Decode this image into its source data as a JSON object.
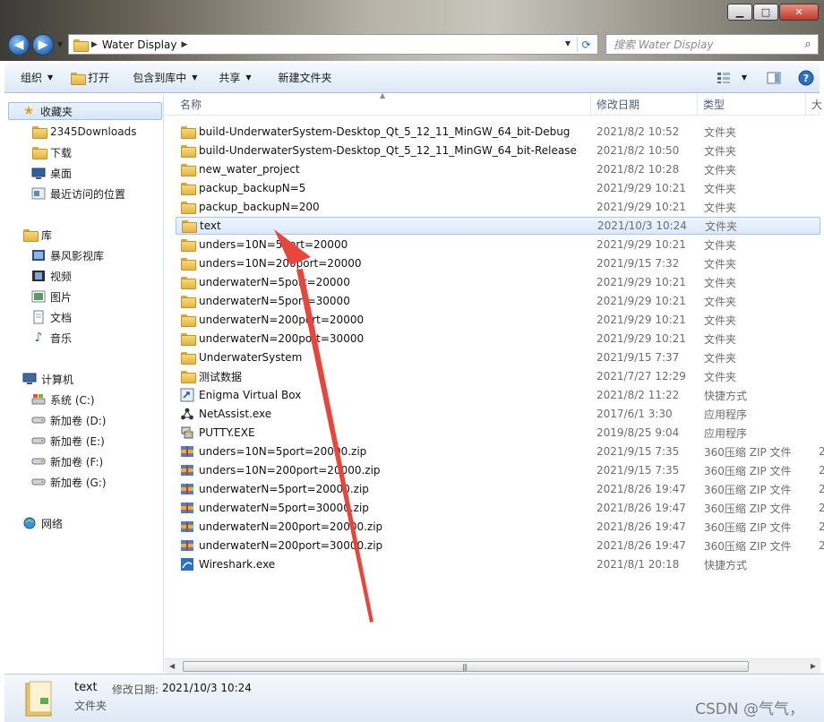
{
  "window": {
    "minimize_label": "▁",
    "maximize_label": "□",
    "close_label": "✕"
  },
  "address": {
    "crumbs": [
      "Water Display"
    ]
  },
  "search": {
    "placeholder": "搜索 Water Display"
  },
  "toolbar": {
    "organize": "组织",
    "open": "打开",
    "include_in_library": "包含到库中",
    "share": "共享",
    "new_folder": "新建文件夹"
  },
  "nav": {
    "favorites": "收藏夹",
    "favorites_items": [
      "2345Downloads",
      "下载",
      "桌面",
      "最近访问的位置"
    ],
    "libraries": "库",
    "libraries_items": [
      "暴风影视库",
      "视频",
      "图片",
      "文档",
      "音乐"
    ],
    "computer": "计算机",
    "computer_items": [
      "系统 (C:)",
      "新加卷 (D:)",
      "新加卷 (E:)",
      "新加卷 (F:)",
      "新加卷 (G:)"
    ],
    "network": "网络"
  },
  "columns": {
    "name": "名称",
    "modified": "修改日期",
    "type": "类型",
    "size": "大"
  },
  "files": [
    {
      "name": "build-UnderwaterSystem-Desktop_Qt_5_12_11_MinGW_64_bit-Debug",
      "date": "2021/8/2 10:52",
      "type": "文件夹",
      "icon": "folder-icon",
      "size": ""
    },
    {
      "name": "build-UnderwaterSystem-Desktop_Qt_5_12_11_MinGW_64_bit-Release",
      "date": "2021/8/2 10:50",
      "type": "文件夹",
      "icon": "folder-icon",
      "size": ""
    },
    {
      "name": "new_water_project",
      "date": "2021/8/2 10:28",
      "type": "文件夹",
      "icon": "folder-icon",
      "size": ""
    },
    {
      "name": "packup_backupN=5",
      "date": "2021/9/29 10:21",
      "type": "文件夹",
      "icon": "folder-icon",
      "size": ""
    },
    {
      "name": "packup_backupN=200",
      "date": "2021/9/29 10:21",
      "type": "文件夹",
      "icon": "folder-icon",
      "size": ""
    },
    {
      "name": "text",
      "date": "2021/10/3 10:24",
      "type": "文件夹",
      "icon": "folder-icon",
      "size": "",
      "selected": true
    },
    {
      "name": "unders=10N=5port=20000",
      "date": "2021/9/29 10:21",
      "type": "文件夹",
      "icon": "folder-icon",
      "size": ""
    },
    {
      "name": "unders=10N=200port=20000",
      "date": "2021/9/15 7:32",
      "type": "文件夹",
      "icon": "folder-icon",
      "size": ""
    },
    {
      "name": "underwaterN=5port=20000",
      "date": "2021/9/29 10:21",
      "type": "文件夹",
      "icon": "folder-icon",
      "size": ""
    },
    {
      "name": "underwaterN=5port=30000",
      "date": "2021/9/29 10:21",
      "type": "文件夹",
      "icon": "folder-icon",
      "size": ""
    },
    {
      "name": "underwaterN=200port=20000",
      "date": "2021/9/29 10:21",
      "type": "文件夹",
      "icon": "folder-icon",
      "size": ""
    },
    {
      "name": "underwaterN=200port=30000",
      "date": "2021/9/29 10:21",
      "type": "文件夹",
      "icon": "folder-icon",
      "size": ""
    },
    {
      "name": "UnderwaterSystem",
      "date": "2021/9/15 7:37",
      "type": "文件夹",
      "icon": "folder-icon",
      "size": ""
    },
    {
      "name": "测试数据",
      "date": "2021/7/27 12:29",
      "type": "文件夹",
      "icon": "folder-icon",
      "size": ""
    },
    {
      "name": "Enigma Virtual Box",
      "date": "2021/8/2 11:22",
      "type": "快捷方式",
      "icon": "shortcut-icon",
      "size": ""
    },
    {
      "name": "NetAssist.exe",
      "date": "2017/6/1 3:30",
      "type": "应用程序",
      "icon": "network-app-icon",
      "size": ""
    },
    {
      "name": "PUTTY.EXE",
      "date": "2019/8/25 9:04",
      "type": "应用程序",
      "icon": "putty-icon",
      "size": ""
    },
    {
      "name": "unders=10N=5port=20000.zip",
      "date": "2021/9/15 7:35",
      "type": "360压缩 ZIP 文件",
      "icon": "zip-icon",
      "size": "2"
    },
    {
      "name": "unders=10N=200port=20000.zip",
      "date": "2021/9/15 7:35",
      "type": "360压缩 ZIP 文件",
      "icon": "zip-icon",
      "size": "2"
    },
    {
      "name": "underwaterN=5port=20000.zip",
      "date": "2021/8/26 19:47",
      "type": "360压缩 ZIP 文件",
      "icon": "zip-icon",
      "size": "2"
    },
    {
      "name": "underwaterN=5port=30000.zip",
      "date": "2021/8/26 19:47",
      "type": "360压缩 ZIP 文件",
      "icon": "zip-icon",
      "size": "2"
    },
    {
      "name": "underwaterN=200port=20000.zip",
      "date": "2021/8/26 19:47",
      "type": "360压缩 ZIP 文件",
      "icon": "zip-icon",
      "size": "2"
    },
    {
      "name": "underwaterN=200port=30000.zip",
      "date": "2021/8/26 19:47",
      "type": "360压缩 ZIP 文件",
      "icon": "zip-icon",
      "size": "2"
    },
    {
      "name": "Wireshark.exe",
      "date": "2021/8/1 20:18",
      "type": "快捷方式",
      "icon": "wireshark-icon",
      "size": ""
    }
  ],
  "details": {
    "name": "text",
    "modified_label": "修改日期:",
    "modified_value": "2021/10/3 10:24",
    "type": "文件夹"
  },
  "watermark": "CSDN @气气，",
  "colors": {
    "selection": "#dbe9fb",
    "annotation_arrow": "#e8463a",
    "header_text": "#4c607a"
  }
}
